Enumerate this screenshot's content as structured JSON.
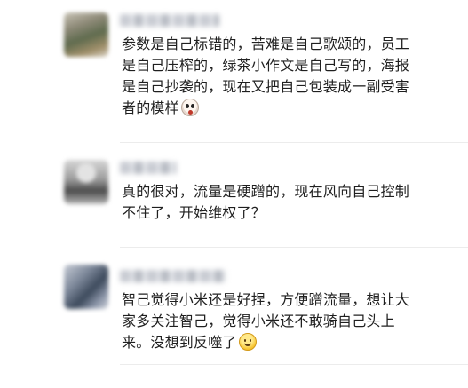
{
  "comments": [
    {
      "lines": [
        "参数是自己标错的，苦难是自己歌颂的，员工",
        "是自己压榨的，绿茶小作文是自己写的，海报",
        "是自己抄袭的，现在又把自己包装成一副受害",
        "者的模样"
      ],
      "emoji_icon": "scared-face-icon"
    },
    {
      "lines": [
        "真的很对，流量是硬蹭的，现在风向自己控制",
        "不住了，开始维权了？"
      ]
    },
    {
      "lines": [
        "智己觉得小米还是好捏，方便蹭流量，想让大",
        "家多关注智己，觉得小米还不敢骑自己头上",
        "来。没想到反噬了"
      ],
      "emoji_icon": "smile-face-icon"
    }
  ]
}
